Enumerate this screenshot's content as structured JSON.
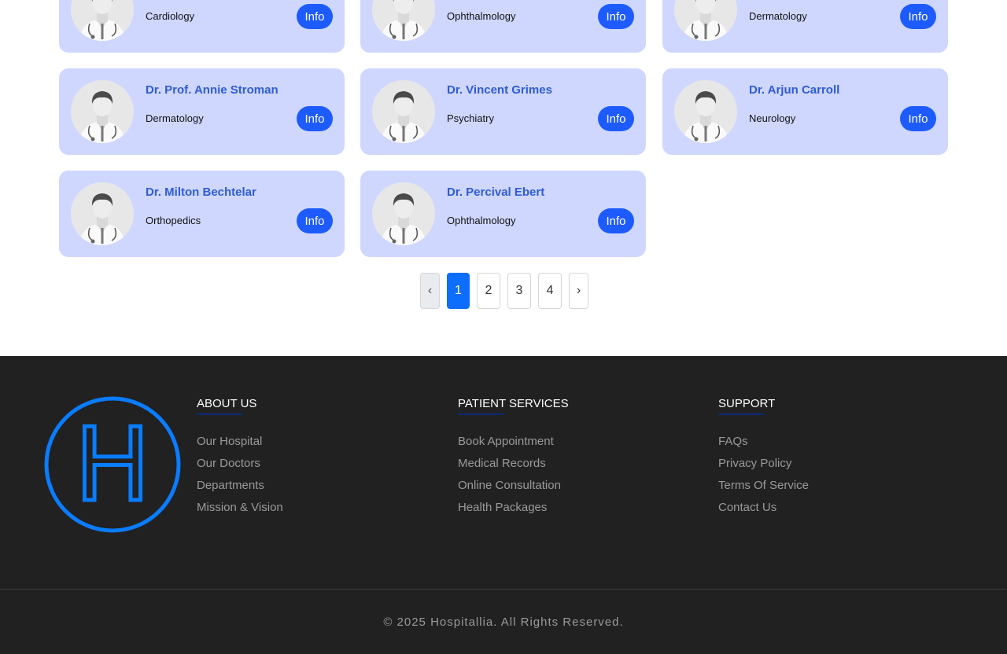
{
  "doctors": [
    {
      "name": "",
      "dept": "Cardiology",
      "info": "Info"
    },
    {
      "name": "",
      "dept": "Ophthalmology",
      "info": "Info"
    },
    {
      "name": "",
      "dept": "Dermatology",
      "info": "Info"
    },
    {
      "name": "Dr. Prof. Annie Stroman",
      "dept": "Dermatology",
      "info": "Info"
    },
    {
      "name": "Dr. Vincent Grimes",
      "dept": "Psychiatry",
      "info": "Info"
    },
    {
      "name": "Dr. Arjun Carroll",
      "dept": "Neurology",
      "info": "Info"
    },
    {
      "name": "Dr. Milton Bechtelar",
      "dept": "Orthopedics",
      "info": "Info"
    },
    {
      "name": "Dr. Percival Ebert",
      "dept": "Ophthalmology",
      "info": "Info"
    }
  ],
  "pagination": {
    "prev": "‹",
    "pages": [
      "1",
      "2",
      "3",
      "4"
    ],
    "current": 1,
    "next": "›"
  },
  "footer": {
    "logo_letter": "H",
    "columns": [
      {
        "title": "ABOUT US",
        "links": [
          "Our Hospital",
          "Our Doctors",
          "Departments",
          "Mission & Vision"
        ]
      },
      {
        "title": "PATIENT SERVICES",
        "links": [
          "Book Appointment",
          "Medical Records",
          "Online Consultation",
          "Health Packages"
        ]
      },
      {
        "title": "SUPPORT",
        "links": [
          "FAQs",
          "Privacy Policy",
          "Terms Of Service",
          "Contact Us"
        ]
      }
    ],
    "copyright": "© 2025 Hospitallia. All Rights Reserved."
  },
  "colors": {
    "card_bg": "#cfd7ff",
    "accent": "#1e5bff",
    "footer_bg": "#212121",
    "logo": "#0a7cff"
  }
}
